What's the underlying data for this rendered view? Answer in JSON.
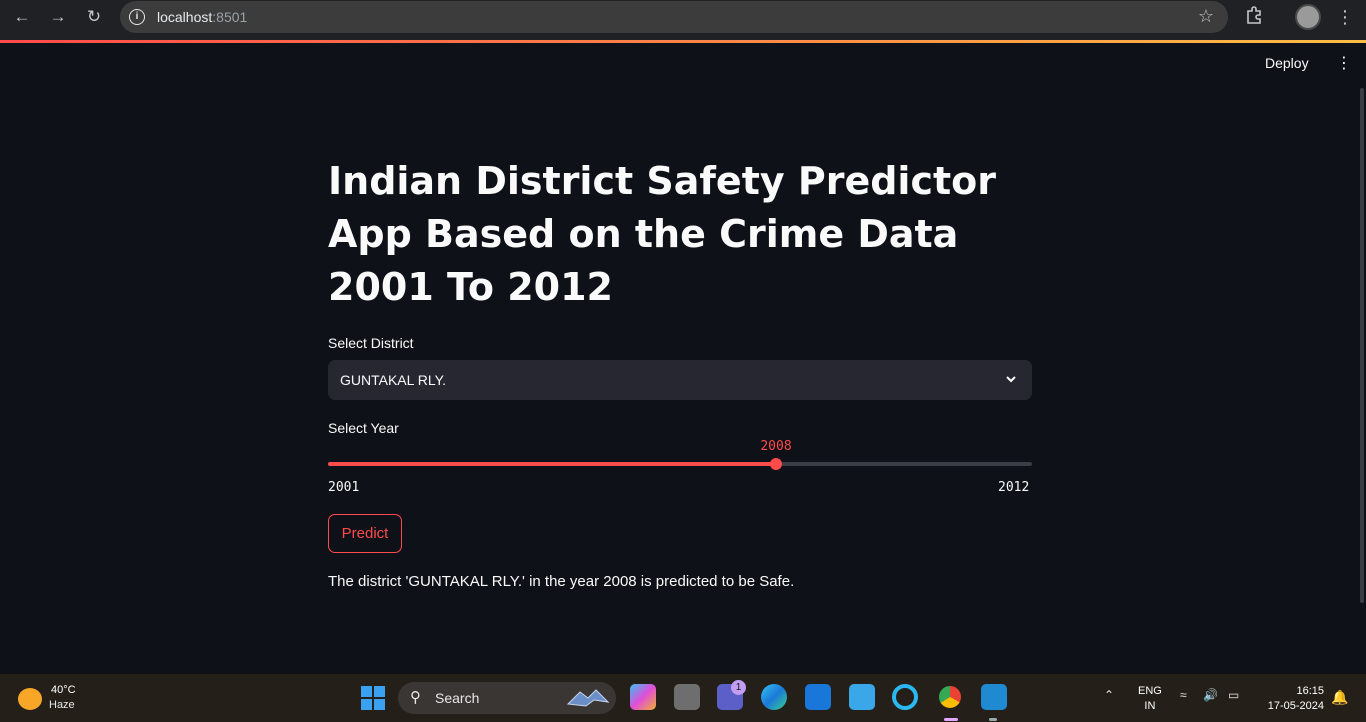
{
  "browser": {
    "url_host": "localhost",
    "url_port": ":8501"
  },
  "toolbar": {
    "deploy_label": "Deploy"
  },
  "main": {
    "title": "Indian District Safety Predictor App Based on the Crime Data 2001 To 2012",
    "district_label": "Select District",
    "district_value": "GUNTAKAL RLY.",
    "year_label": "Select Year",
    "year_value": "2008",
    "year_min": "2001",
    "year_max": "2012",
    "predict_label": "Predict",
    "result_text": "The district 'GUNTAKAL RLY.' in the year 2008 is predicted to be Safe."
  },
  "colors": {
    "accent": "#ff4b4b",
    "background": "#0e1117",
    "widget_bg": "#262730"
  },
  "taskbar": {
    "weather_temp": "40°C",
    "weather_desc": "Haze",
    "search_label": "Search",
    "teams_badge": "1",
    "lang_line1": "ENG",
    "lang_line2": "IN",
    "time": "16:15",
    "date": "17-05-2024"
  }
}
